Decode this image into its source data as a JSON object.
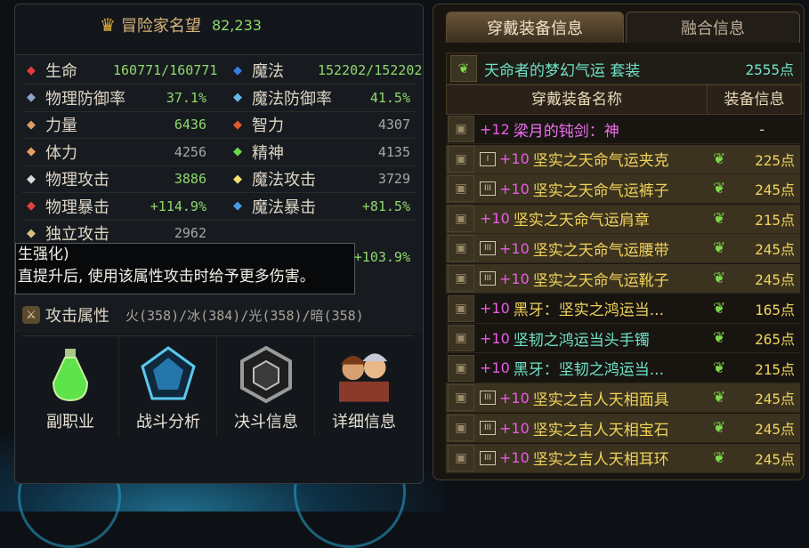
{
  "reputation": {
    "label": "冒险家名望",
    "value": "82,233"
  },
  "stats": [
    {
      "name": "生命",
      "value": "160771/160771",
      "icon": "heart-icon",
      "color": "#e23a3a"
    },
    {
      "name": "魔法",
      "value": "152202/152202",
      "icon": "blue-heart-icon",
      "color": "#3a7ae2"
    },
    {
      "name": "物理防御率",
      "value": "37.1%",
      "icon": "shield-icon",
      "color": "#8fa4c8"
    },
    {
      "name": "魔法防御率",
      "value": "41.5%",
      "icon": "orb-icon",
      "color": "#6ab8e8"
    },
    {
      "name": "力量",
      "value": "6436",
      "icon": "arm-icon",
      "color": "#d8a060"
    },
    {
      "name": "智力",
      "value": "4307",
      "icon": "eye-icon",
      "color": "#e05a2a"
    },
    {
      "name": "体力",
      "value": "4256",
      "icon": "body-icon",
      "color": "#e8a060"
    },
    {
      "name": "精神",
      "value": "4135",
      "icon": "spirit-icon",
      "color": "#6ad84a"
    },
    {
      "name": "物理攻击",
      "value": "3886",
      "icon": "sword-icon",
      "color": "#d8d8d8"
    },
    {
      "name": "魔法攻击",
      "value": "3729",
      "icon": "sparkle-icon",
      "color": "#f0e070"
    },
    {
      "name": "物理暴击",
      "value": "+114.9%",
      "icon": "target-icon",
      "color": "#e04040"
    },
    {
      "name": "魔法暴击",
      "value": "+81.5%",
      "icon": "blue-target-icon",
      "color": "#4a9ae8"
    },
    {
      "name": "独立攻击",
      "value": "2962",
      "icon": "independent-icon",
      "color": "#d8c080"
    }
  ],
  "hidden_stat_value": "+103.9%",
  "tooltip": {
    "line1": "生强化)",
    "line2": "直提升后, 使用该属性攻击时给予更多伤害。"
  },
  "attack_attr": {
    "name": "攻击属性",
    "elements": "火(358)/冰(384)/光(358)/暗(358)"
  },
  "menu": [
    {
      "label": "副职业",
      "icon": "potion-icon"
    },
    {
      "label": "战斗分析",
      "icon": "radar-icon"
    },
    {
      "label": "决斗信息",
      "icon": "hexagon-icon"
    },
    {
      "label": "详细信息",
      "icon": "character-portrait-icon"
    }
  ],
  "tabs": {
    "active": "穿戴装备信息",
    "inactive": "融合信息"
  },
  "set": {
    "name": "天命者的梦幻气运  套装",
    "points": "2555点"
  },
  "header": {
    "col1": "穿戴装备名称",
    "col2": "装备信息"
  },
  "equipment": [
    {
      "box": "",
      "plus": "+12",
      "name": "梁月的钝剑：神",
      "color": "pink",
      "leaf": false,
      "points": "-"
    },
    {
      "box": "I",
      "plus": "+10",
      "name": "坚实之天命气运夹克",
      "color": "gold",
      "leaf": true,
      "points": "225点",
      "hl": true
    },
    {
      "box": "III",
      "plus": "+10",
      "name": "坚实之天命气运裤子",
      "color": "gold",
      "leaf": true,
      "points": "245点",
      "hl": true
    },
    {
      "box": "",
      "plus": "+10",
      "name": "坚实之天命气运肩章",
      "color": "gold",
      "leaf": true,
      "points": "215点",
      "hl": true
    },
    {
      "box": "III",
      "plus": "+10",
      "name": "坚实之天命气运腰带",
      "color": "gold",
      "leaf": true,
      "points": "245点",
      "hl": true
    },
    {
      "box": "III",
      "plus": "+10",
      "name": "坚实之天命气运靴子",
      "color": "gold",
      "leaf": true,
      "points": "245点",
      "hl": true
    },
    {
      "box": "",
      "plus": "+10",
      "name": "黑牙：坚实之鸿运当...",
      "color": "gold",
      "leaf": true,
      "points": "165点"
    },
    {
      "box": "",
      "plus": "+10",
      "name": "坚韧之鸿运当头手镯",
      "color": "cyan",
      "leaf": true,
      "points": "265点"
    },
    {
      "box": "",
      "plus": "+10",
      "name": "黑牙：坚韧之鸿运当...",
      "color": "cyan",
      "leaf": true,
      "points": "215点"
    },
    {
      "box": "III",
      "plus": "+10",
      "name": "坚实之吉人天相面具",
      "color": "gold",
      "leaf": true,
      "points": "245点",
      "hl": true
    },
    {
      "box": "III",
      "plus": "+10",
      "name": "坚实之吉人天相宝石",
      "color": "gold",
      "leaf": true,
      "points": "245点",
      "hl": true
    },
    {
      "box": "III",
      "plus": "+10",
      "name": "坚实之吉人天相耳环",
      "color": "gold",
      "leaf": true,
      "points": "245点",
      "hl": true
    }
  ]
}
